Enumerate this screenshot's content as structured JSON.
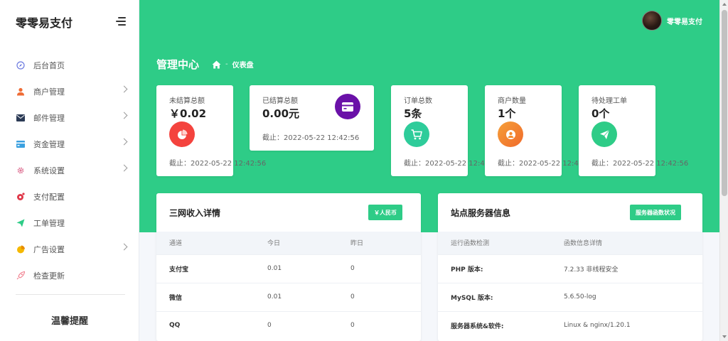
{
  "brand": "零零易支付",
  "sidebar": {
    "items": [
      {
        "label": "后台首页",
        "icon": "compass-icon",
        "color": "#6c7ae0",
        "chevron": false
      },
      {
        "label": "商户管理",
        "icon": "user-icon",
        "color": "#ef6c35",
        "chevron": true
      },
      {
        "label": "邮件管理",
        "icon": "mail-icon",
        "color": "#2b3a55",
        "chevron": true
      },
      {
        "label": "资金管理",
        "icon": "card-icon",
        "color": "#3aa0e0",
        "chevron": true
      },
      {
        "label": "系统设置",
        "icon": "gear-icon",
        "color": "#e07a9a",
        "chevron": true
      },
      {
        "label": "支付配置",
        "icon": "pay-config-icon",
        "color": "#e0394a",
        "chevron": false
      },
      {
        "label": "工单管理",
        "icon": "send-icon",
        "color": "#2ecc87",
        "chevron": false
      },
      {
        "label": "广告设置",
        "icon": "pie-icon",
        "color": "#f5b800",
        "chevron": true
      },
      {
        "label": "检查更新",
        "icon": "rocket-icon",
        "color": "#f07a8a",
        "chevron": false
      }
    ],
    "tips_title": "温馨提醒"
  },
  "header": {
    "username": "零零易支付",
    "page_title": "管理中心",
    "breadcrumb_sep": "-",
    "breadcrumb_current": "仪表盘"
  },
  "stats": [
    {
      "title": "未结算总额",
      "value": "￥0.02",
      "foot": "截止：2022-05-22 12:42:56",
      "icon": "pie-chart-icon",
      "color": "#f4433e"
    },
    {
      "title": "已结算总额",
      "value": "0.00元",
      "foot": "截止：2022-05-22 12:42:56",
      "icon": "credit-card-icon",
      "color": "#6a11a8"
    },
    {
      "title": "订单总数",
      "value": "5条",
      "foot": "截止：2022-05-22 12:42:56",
      "icon": "cart-icon",
      "color": "#2ecc9a"
    },
    {
      "title": "商户数量",
      "value": "1个",
      "foot": "截止：2022-05-22 12:42:56",
      "icon": "user-circle-icon",
      "color": "#f58a2a"
    },
    {
      "title": "待处理工单",
      "value": "0个",
      "foot": "截止：2022-05-22 12:42:56",
      "icon": "paper-plane-icon",
      "color": "#2ecc87"
    }
  ],
  "income_panel": {
    "title": "三网收入详情",
    "button": "￥人民币",
    "columns": [
      "通道",
      "今日",
      "昨日"
    ],
    "rows": [
      [
        "支付宝",
        "0.01",
        "0"
      ],
      [
        "微信",
        "0.01",
        "0"
      ],
      [
        "QQ",
        "0",
        "0"
      ]
    ]
  },
  "server_panel": {
    "title": "站点服务器信息",
    "button": "服务器函数状况",
    "columns": [
      "运行函数检测",
      "函数信息详情"
    ],
    "rows": [
      [
        "PHP 版本:",
        "7.2.33 非线程安全"
      ],
      [
        "MySQL 版本:",
        "5.6.50-log"
      ],
      [
        "服务器系统&软件:",
        "Linux & nginx/1.20.1"
      ]
    ]
  }
}
